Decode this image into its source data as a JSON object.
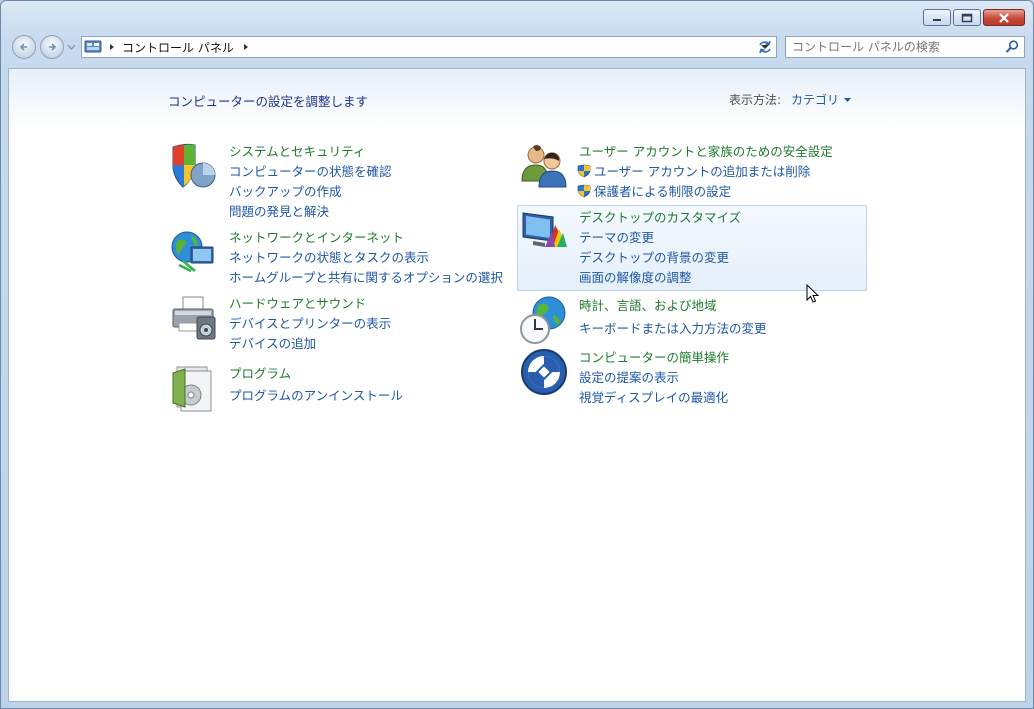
{
  "window": {
    "minimize_label": "minimize",
    "maximize_label": "maximize",
    "close_label": "close"
  },
  "address": {
    "breadcrumb": "コントロール パネル"
  },
  "search": {
    "placeholder": "コントロール パネルの検索"
  },
  "main": {
    "heading": "コンピューターの設定を調整します",
    "view_by_label": "表示方法:",
    "view_by_value": "カテゴリ"
  },
  "left": [
    {
      "title": "システムとセキュリティ",
      "icon": "shield-icon",
      "links": [
        "コンピューターの状態を確認",
        "バックアップの作成",
        "問題の発見と解決"
      ]
    },
    {
      "title": "ネットワークとインターネット",
      "icon": "network-globe-icon",
      "links": [
        "ネットワークの状態とタスクの表示",
        "ホームグループと共有に関するオプションの選択"
      ]
    },
    {
      "title": "ハードウェアとサウンド",
      "icon": "printer-icon",
      "links": [
        "デバイスとプリンターの表示",
        "デバイスの追加"
      ]
    },
    {
      "title": "プログラム",
      "icon": "programs-icon",
      "links": [
        "プログラムのアンインストール"
      ]
    }
  ],
  "right": [
    {
      "title": "ユーザー アカウントと家族のための安全設定",
      "icon": "users-icon",
      "links": [
        "ユーザー アカウントの追加または削除",
        "保護者による制限の設定"
      ]
    },
    {
      "title": "デスクトップのカスタマイズ",
      "icon": "desktop-icon",
      "links": [
        "テーマの変更",
        "デスクトップの背景の変更",
        "画面の解像度の調整"
      ]
    },
    {
      "title": "時計、言語、および地域",
      "icon": "clock-globe-icon",
      "links": [
        "キーボードまたは入力方法の変更"
      ]
    },
    {
      "title": "コンピューターの簡単操作",
      "icon": "ease-of-access-icon",
      "links": [
        "設定の提案の表示",
        "視覚ディスプレイの最適化"
      ]
    }
  ]
}
